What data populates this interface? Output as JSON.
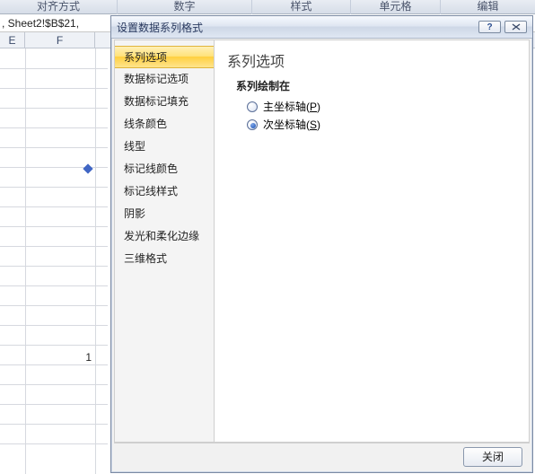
{
  "ribbon": {
    "groups": [
      "对齐方式",
      "数字",
      "样式",
      "单元格",
      "编辑"
    ]
  },
  "formula_bar": ", Sheet2!$B$21,",
  "columns": {
    "e": "E",
    "f": "F"
  },
  "cells": {
    "val1": "1"
  },
  "dialog": {
    "title": "设置数据系列格式",
    "helpTip": "?",
    "nav": [
      "系列选项",
      "数据标记选项",
      "数据标记填充",
      "线条颜色",
      "线型",
      "标记线颜色",
      "标记线样式",
      "阴影",
      "发光和柔化边缘",
      "三维格式"
    ],
    "selected_index": 0,
    "heading": "系列选项",
    "subheading": "系列绘制在",
    "radios": {
      "primary": {
        "label": "主坐标轴(",
        "mnemonic": "P",
        "tail": ")"
      },
      "secondary": {
        "label": "次坐标轴(",
        "mnemonic": "S",
        "tail": ")"
      }
    },
    "checked": "secondary",
    "close_btn": "关闭"
  }
}
